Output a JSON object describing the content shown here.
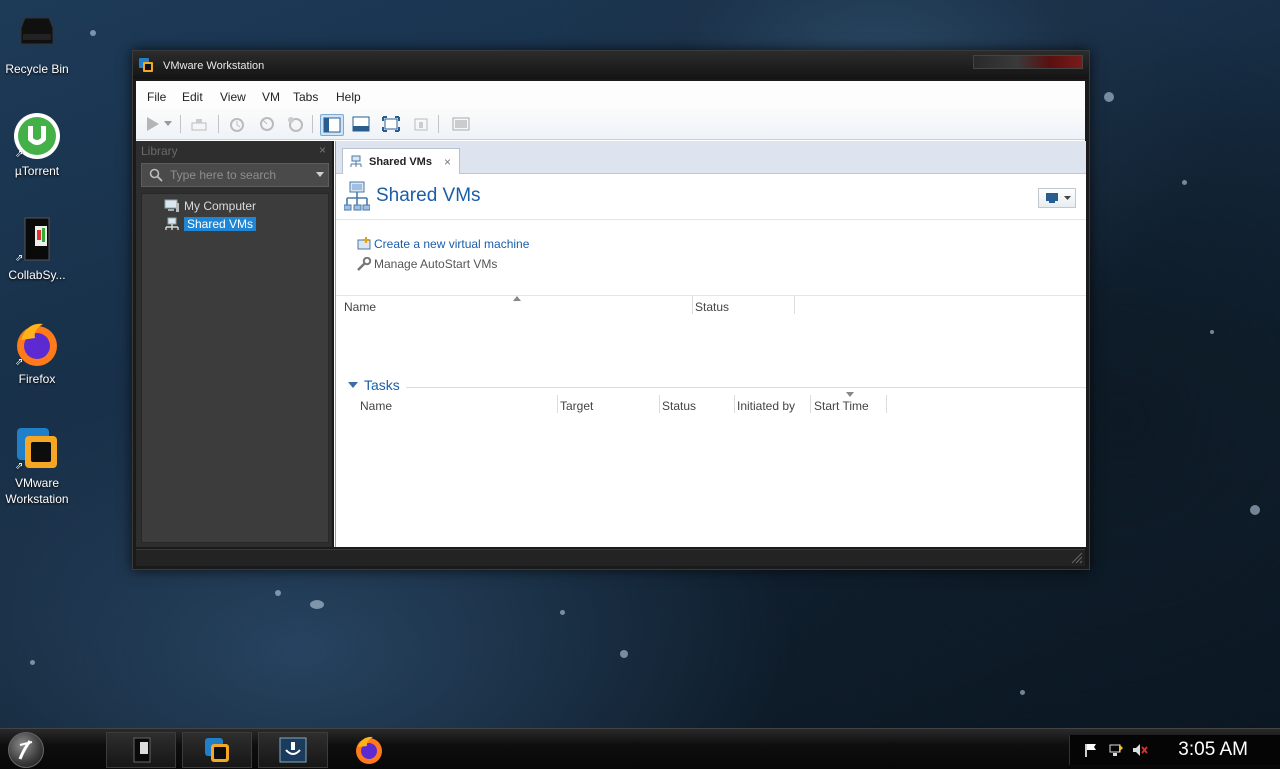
{
  "desktop": {
    "icons": [
      {
        "label": "Recycle Bin"
      },
      {
        "label": "µTorrent"
      },
      {
        "label": "CollabSy..."
      },
      {
        "label": "Firefox"
      },
      {
        "label": "VMware\nWorkstation",
        "line1": "VMware",
        "line2": "Workstation"
      }
    ]
  },
  "window": {
    "title": "VMware Workstation",
    "menu": [
      "File",
      "Edit",
      "View",
      "VM",
      "Tabs",
      "Help"
    ],
    "library": {
      "title": "Library",
      "close": "×",
      "search_placeholder": "Type here to search",
      "tree": [
        {
          "label": "My Computer",
          "selected": false
        },
        {
          "label": "Shared VMs",
          "selected": true
        }
      ]
    },
    "tab": {
      "label": "Shared VMs",
      "close": "×"
    },
    "page_title": "Shared VMs",
    "actions": [
      {
        "label": "Create a new virtual machine",
        "color": "#1a5ea8"
      },
      {
        "label": "Manage AutoStart VMs",
        "color": "#555555"
      }
    ],
    "vm_table": {
      "columns": [
        "Name",
        "Status"
      ]
    },
    "tasks": {
      "title": "Tasks",
      "columns": [
        "Name",
        "Target",
        "Status",
        "Initiated by",
        "Start Time"
      ]
    }
  },
  "taskbar": {
    "clock": "3:05 AM"
  },
  "colors": {
    "accent_blue": "#1a5ea8",
    "selection": "#1f86d6"
  }
}
